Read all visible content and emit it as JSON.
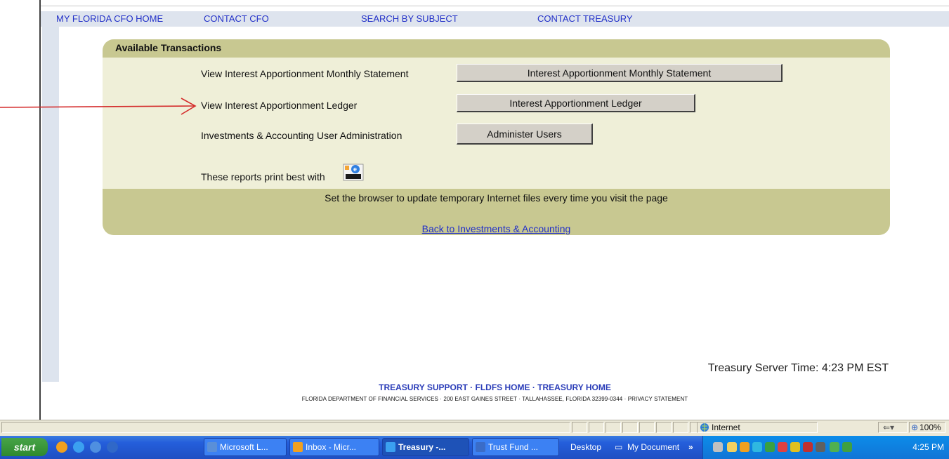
{
  "nav": {
    "items": [
      "MY FLORIDA CFO HOME",
      "CONTACT CFO",
      "SEARCH BY SUBJECT",
      "CONTACT TREASURY"
    ]
  },
  "panel": {
    "title": "Available Transactions",
    "rows": [
      {
        "label": "View Interest Apportionment Monthly Statement",
        "button": "Interest Apportionment Monthly Statement"
      },
      {
        "label": "View Interest Apportionment Ledger",
        "button": "Interest Apportionment Ledger"
      },
      {
        "label": "Investments & Accounting User Administration",
        "button": "Administer Users"
      }
    ],
    "print_note": "These reports print best with",
    "notice": "Set the browser to update temporary Internet files every time you visit the page",
    "back_link": "Back to Investments & Accounting"
  },
  "server_time": "Treasury Server Time: 4:23 PM EST",
  "footer": {
    "links": [
      "TREASURY SUPPORT",
      "FLDFS HOME",
      "TREASURY HOME"
    ],
    "separator": " · ",
    "address": "FLORIDA DEPARTMENT OF FINANCIAL SERVICES · 200 EAST GAINES STREET · TALLAHASSEE, FLORIDA 32399-0344 · PRIVACY STATEMENT"
  },
  "statusbar": {
    "zone": "Internet",
    "zoom": "100%"
  },
  "taskbar": {
    "start": "start",
    "tasks": [
      {
        "label": "Microsoft L...",
        "icon": "lync-icon"
      },
      {
        "label": "Inbox - Micr...",
        "icon": "outlook-icon"
      },
      {
        "label": "Treasury -...",
        "icon": "ie-icon",
        "active": true
      },
      {
        "label": "Trust Fund ...",
        "icon": "word-icon"
      }
    ],
    "desktop": "Desktop",
    "my_documents": "My Document",
    "clock": "4:25 PM"
  },
  "colors": {
    "nav_link": "#2230c8",
    "panel_header": "#c8c891",
    "panel_body": "#efefd8",
    "arrow": "#d42a2a"
  }
}
